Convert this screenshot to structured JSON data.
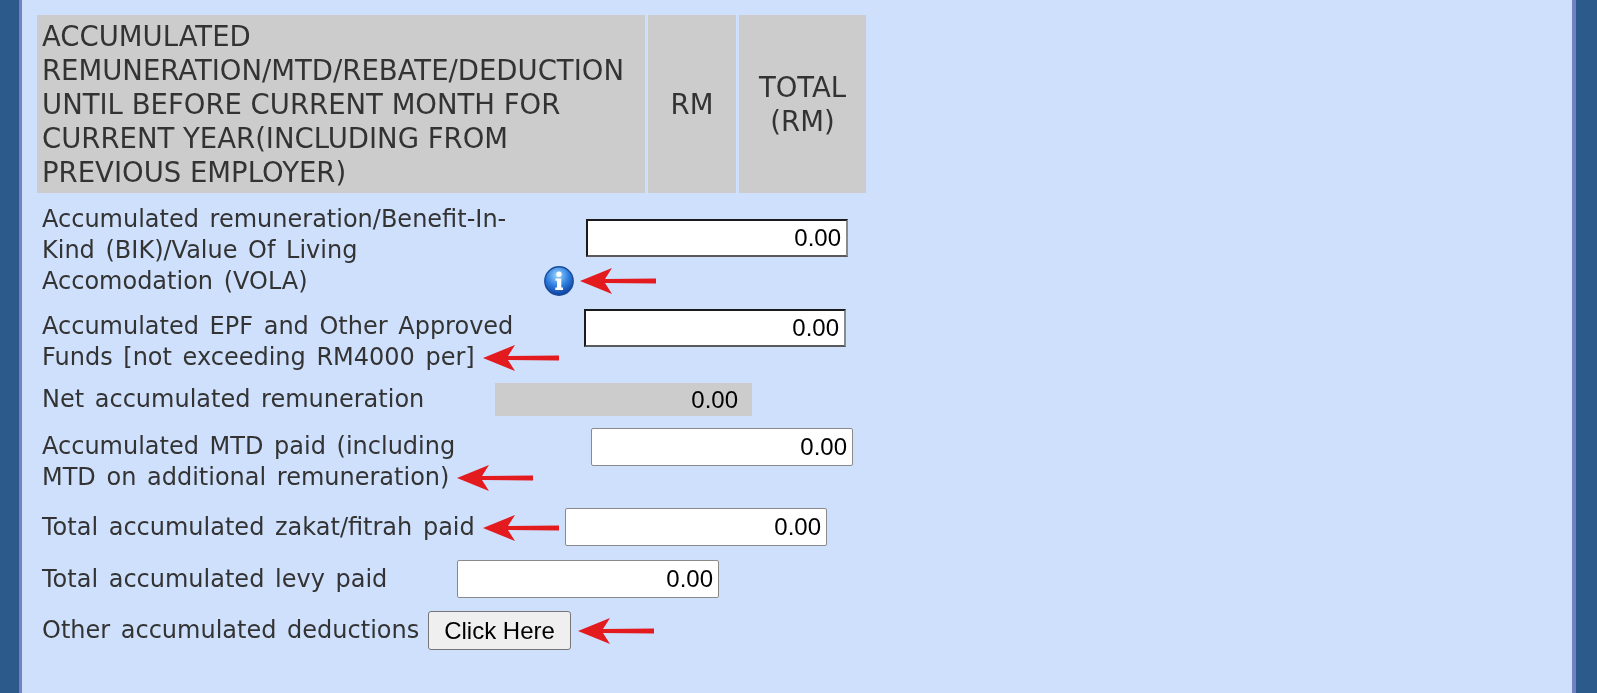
{
  "table": {
    "columns": [
      "ACCUMULATED REMUNERATION/MTD/REBATE/DEDUCTION UNTIL BEFORE CURRENT MONTH FOR CURRENT YEAR(INCLUDING FROM PREVIOUS EMPLOYER)",
      "RM",
      "TOTAL (RM)"
    ],
    "rows": [
      {
        "label": "Accumulated remuneration/Benefit-In-Kind (BIK)/Value Of Living Accomodation (VOLA)",
        "info_icon": true,
        "annotated": true,
        "kind": "inset",
        "value": "0.00"
      },
      {
        "label": "Accumulated EPF and Other Approved Funds [not exceeding RM4000 per]",
        "info_icon": false,
        "annotated": true,
        "kind": "inset",
        "value": "0.00"
      },
      {
        "label": "Net accumulated remuneration",
        "info_icon": false,
        "annotated": false,
        "kind": "readonly",
        "value": "0.00"
      },
      {
        "label": "Accumulated MTD paid (including MTD on additional remuneration)",
        "info_icon": false,
        "annotated": true,
        "kind": "input",
        "value": "0.00"
      },
      {
        "label": "Total accumulated zakat/fitrah paid",
        "info_icon": false,
        "annotated": true,
        "kind": "input",
        "value": "0.00"
      },
      {
        "label": "Total accumulated levy paid",
        "info_icon": false,
        "annotated": false,
        "kind": "input",
        "value": "0.00"
      },
      {
        "label": "Other accumulated deductions",
        "info_icon": false,
        "annotated": true,
        "kind": "button",
        "button_label": "Click Here"
      }
    ]
  }
}
